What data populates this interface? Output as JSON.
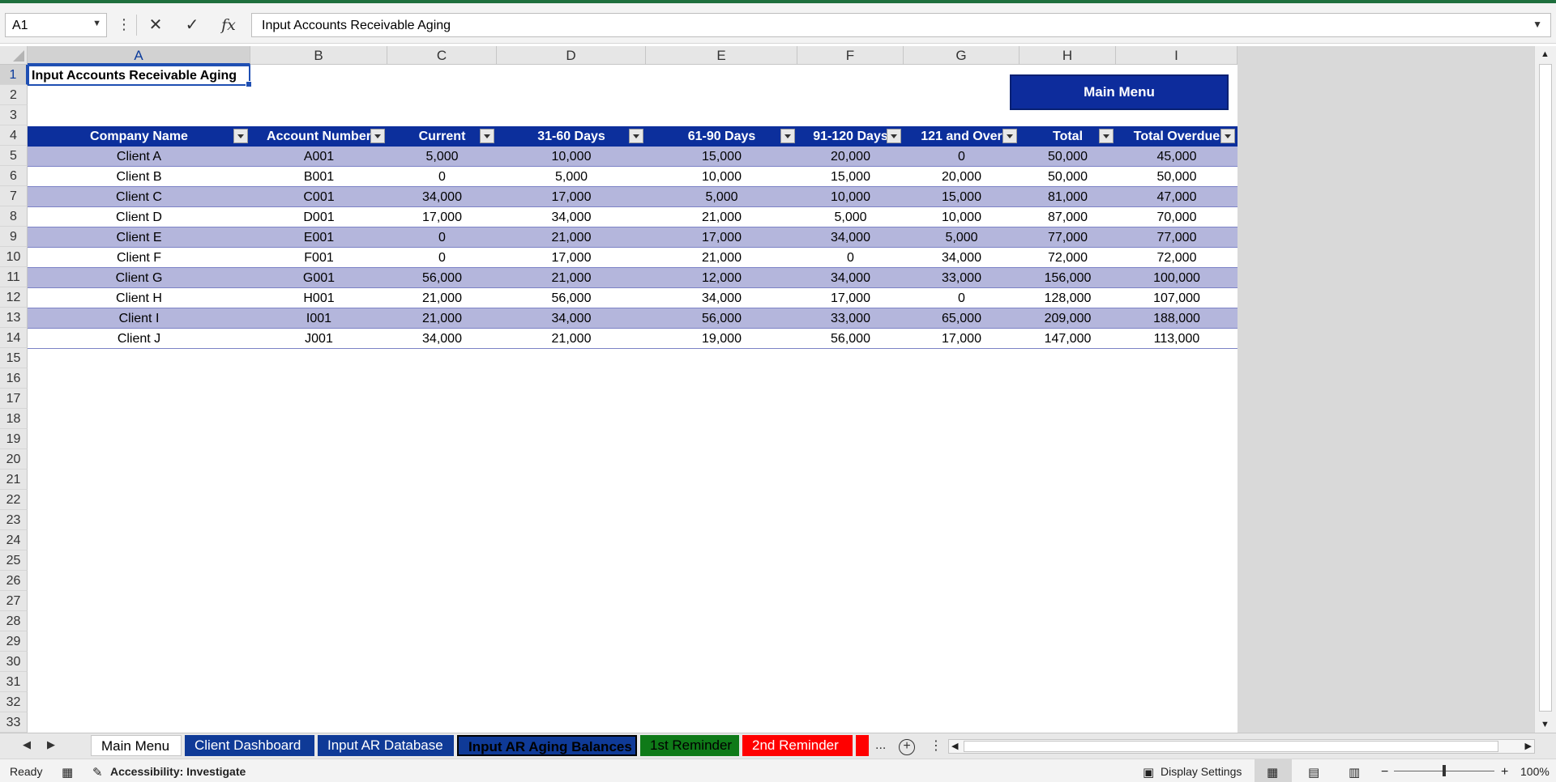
{
  "formula_bar": {
    "name_box": "A1",
    "formula": "Input Accounts Receivable Aging"
  },
  "columns": [
    "A",
    "B",
    "C",
    "D",
    "E",
    "F",
    "G",
    "H",
    "I"
  ],
  "rows": [
    "1",
    "2",
    "3",
    "4",
    "5",
    "6",
    "7",
    "8",
    "9",
    "10",
    "11",
    "12",
    "13",
    "14",
    "15",
    "16",
    "17",
    "18",
    "19",
    "20",
    "21",
    "22",
    "23",
    "24",
    "25",
    "26",
    "27",
    "28",
    "29",
    "30",
    "31",
    "32",
    "33"
  ],
  "sheet": {
    "title": "Input Accounts Receivable Aging",
    "main_menu_button": "Main Menu"
  },
  "table": {
    "headers": [
      "Company Name",
      "Account Number",
      "Current",
      "31-60 Days",
      "61-90 Days",
      "91-120 Days",
      "121 and Over",
      "Total",
      "Total Overdue"
    ],
    "rows": [
      [
        "Client A",
        "A001",
        "5,000",
        "10,000",
        "15,000",
        "20,000",
        "0",
        "50,000",
        "45,000"
      ],
      [
        "Client B",
        "B001",
        "0",
        "5,000",
        "10,000",
        "15,000",
        "20,000",
        "50,000",
        "50,000"
      ],
      [
        "Client C",
        "C001",
        "34,000",
        "17,000",
        "5,000",
        "10,000",
        "15,000",
        "81,000",
        "47,000"
      ],
      [
        "Client D",
        "D001",
        "17,000",
        "34,000",
        "21,000",
        "5,000",
        "10,000",
        "87,000",
        "70,000"
      ],
      [
        "Client E",
        "E001",
        "0",
        "21,000",
        "17,000",
        "34,000",
        "5,000",
        "77,000",
        "77,000"
      ],
      [
        "Client F",
        "F001",
        "0",
        "17,000",
        "21,000",
        "0",
        "34,000",
        "72,000",
        "72,000"
      ],
      [
        "Client G",
        "G001",
        "56,000",
        "21,000",
        "12,000",
        "34,000",
        "33,000",
        "156,000",
        "100,000"
      ],
      [
        "Client H",
        "H001",
        "21,000",
        "56,000",
        "34,000",
        "17,000",
        "0",
        "128,000",
        "107,000"
      ],
      [
        "Client I",
        "I001",
        "21,000",
        "34,000",
        "56,000",
        "33,000",
        "65,000",
        "209,000",
        "188,000"
      ],
      [
        "Client J",
        "J001",
        "34,000",
        "21,000",
        "19,000",
        "56,000",
        "17,000",
        "147,000",
        "113,000"
      ]
    ]
  },
  "tabs": {
    "main_menu": "Main Menu",
    "client_dashboard": "Client Dashboard",
    "input_ar_database": "Input AR Database",
    "input_ar_aging": "Input AR Aging Balances",
    "reminder1": "1st Reminder",
    "reminder2": "2nd Reminder",
    "more": "..."
  },
  "status": {
    "ready": "Ready",
    "accessibility": "Accessibility: Investigate",
    "display_settings": "Display Settings",
    "zoom": "100%"
  },
  "colors": {
    "header_blue": "#0c2f9c",
    "band_row": "#b4b6dc",
    "tab_green": "#0f7a18",
    "tab_red": "#ff0000"
  }
}
